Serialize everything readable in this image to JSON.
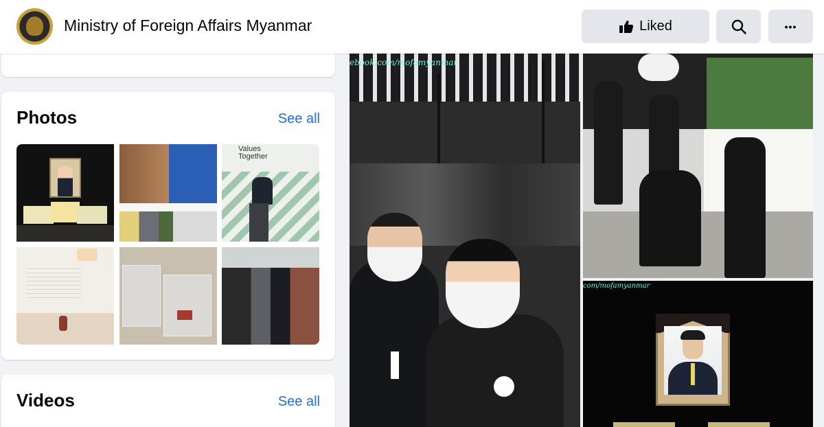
{
  "header": {
    "page_name": "Ministry of Foreign Affairs Myanmar",
    "liked_label": "Liked",
    "logo_icon": "ministry-seal-icon",
    "search_icon": "search-icon",
    "more_icon": "more-dots-icon",
    "more_label": "•••"
  },
  "photos_card": {
    "title": "Photos",
    "see_all": "See all",
    "thumbnails": [
      {
        "tag": "portrait-memorial",
        "sign_text": ""
      },
      {
        "tag": "meeting-table"
      },
      {
        "tag": "speaker-podium",
        "sign_text": "Values Together"
      },
      {
        "tag": "exhibition-room"
      },
      {
        "tag": "display-cases"
      },
      {
        "tag": "crowd-event"
      }
    ]
  },
  "videos_card": {
    "title": "Videos",
    "see_all": "See all"
  },
  "collage": {
    "main_watermark": "ebook.com/mofamyanmar",
    "bottom_right_watermark": "com/mofamyanmar"
  },
  "colors": {
    "link_blue": "#216fdb",
    "button_gray": "#e4e6eb",
    "page_bg": "#f0f2f5",
    "watermark": "#72f0d6"
  }
}
